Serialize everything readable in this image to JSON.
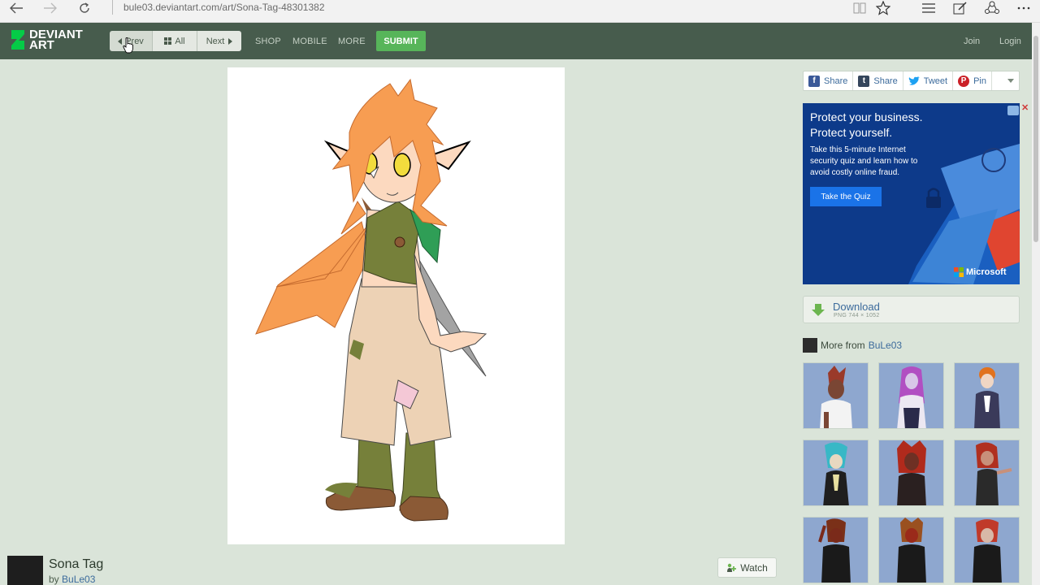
{
  "browser": {
    "url": "bule03.deviantart.com/art/Sona-Tag-48301382"
  },
  "nav": {
    "logo_line1": "DEVIANT",
    "logo_line2": "ART",
    "prev_label": "Prev",
    "all_label": "All",
    "next_label": "Next",
    "shop_label": "SHOP",
    "mobile_label": "MOBILE",
    "more_label": "MORE",
    "submit_label": "SUBMIT",
    "join_label": "Join",
    "login_label": "Login"
  },
  "share": {
    "facebook_label": "Share",
    "tumblr_label": "Share",
    "twitter_label": "Tweet",
    "pinterest_label": "Pin"
  },
  "ad": {
    "headline_line1": "Protect your business.",
    "headline_line2": "Protect yourself.",
    "body": "Take this 5-minute Internet security quiz and learn how to avoid costly online fraud.",
    "cta": "Take the Quiz",
    "brand": "Microsoft"
  },
  "download": {
    "label": "Download",
    "meta": "PNG 744 × 1052"
  },
  "more_from": {
    "prefix": "More from",
    "author": "BuLe03"
  },
  "deviation": {
    "title": "Sona Tag",
    "by": "by",
    "author": "BuLe03",
    "watch_label": "Watch"
  },
  "colors": {
    "nav_bg": "#475c4d",
    "page_bg": "#dae4d9",
    "submit_green": "#57b55a",
    "link_blue": "#3c6b9c"
  }
}
